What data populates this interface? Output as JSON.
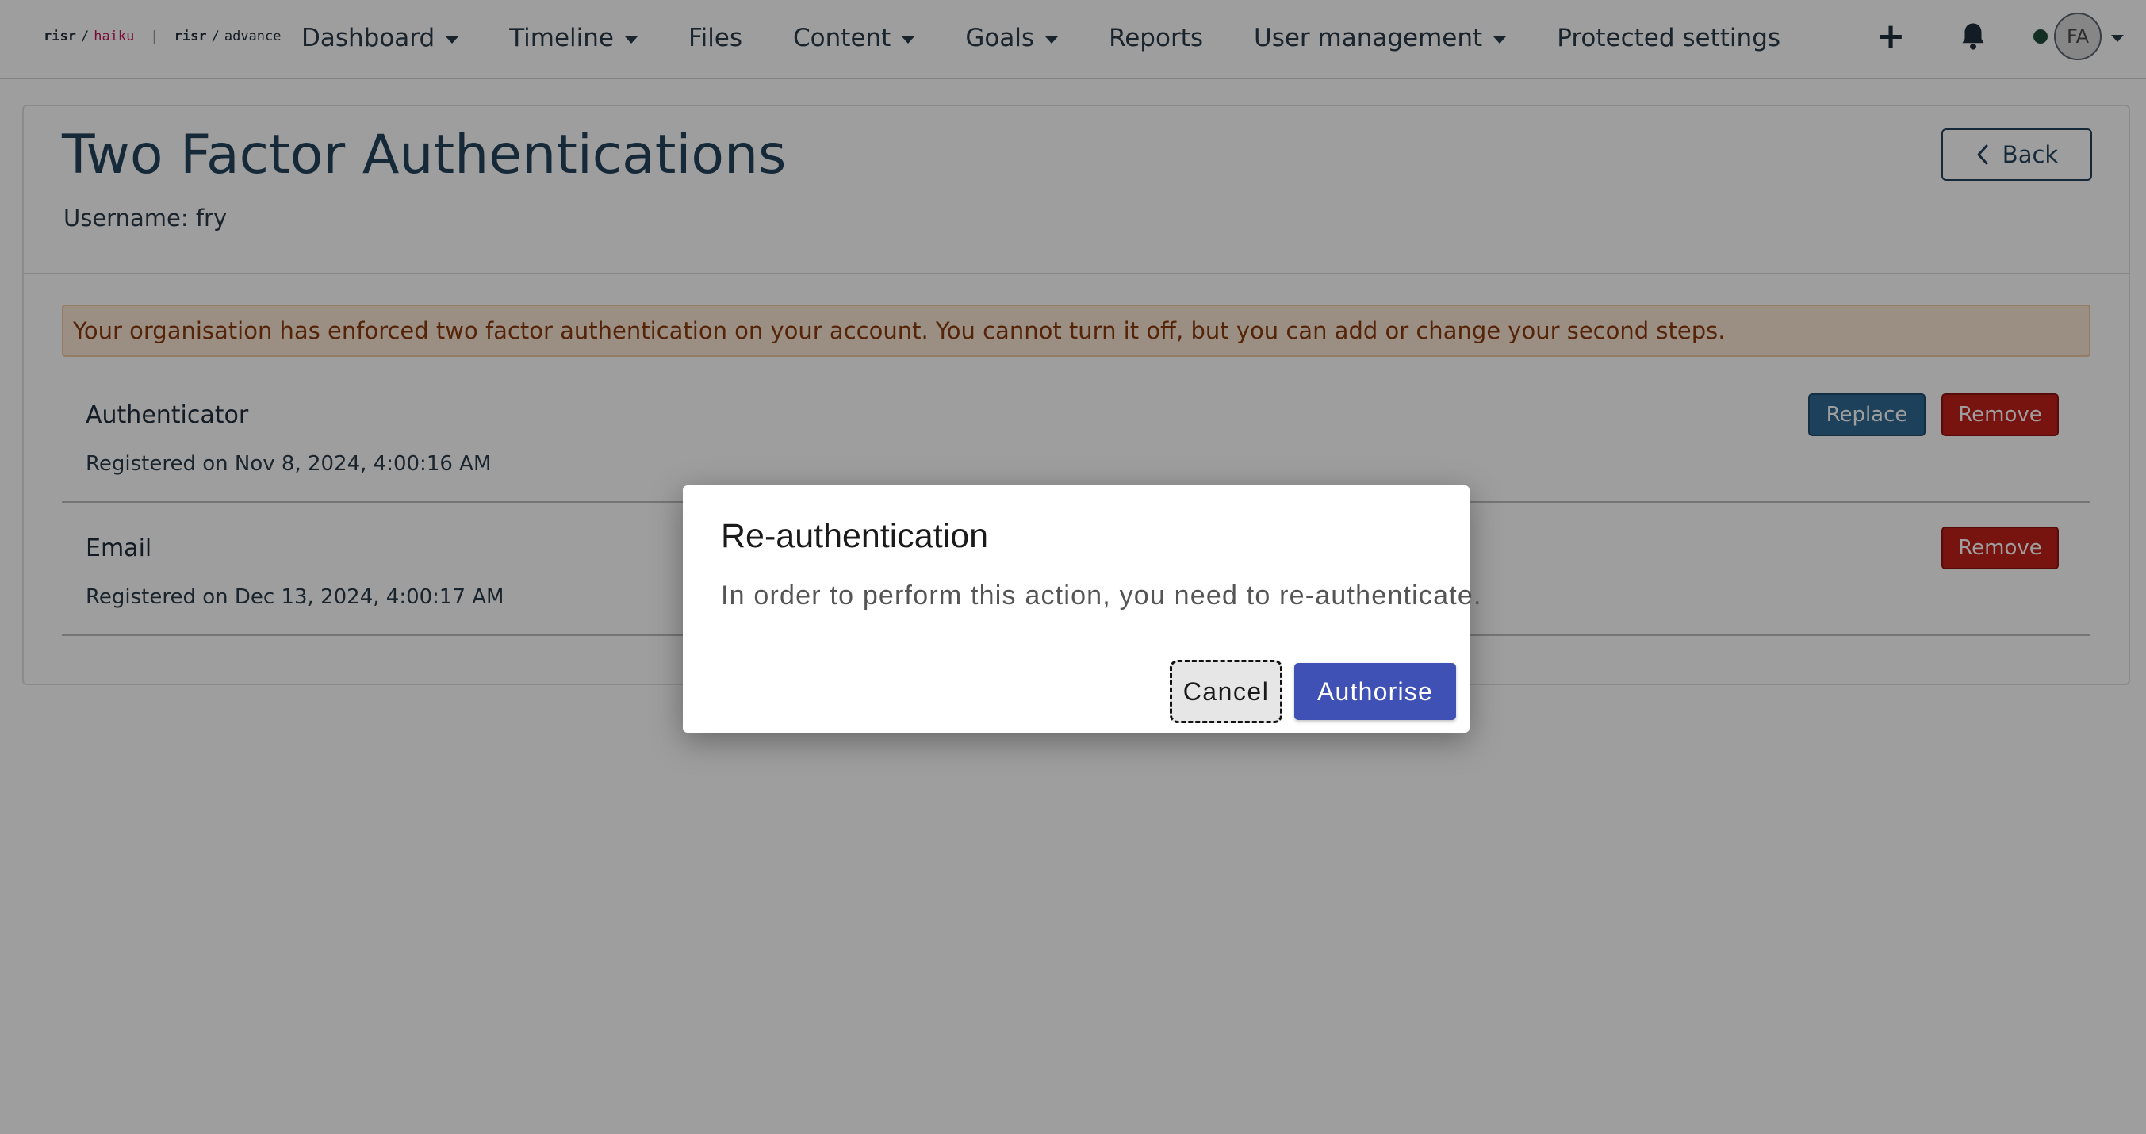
{
  "nav": {
    "logo": {
      "brand1": "risr",
      "product1": "haiku",
      "separator": "|",
      "brand2": "risr",
      "product2": "advance",
      "slash": "/"
    },
    "items": [
      {
        "label": "Dashboard",
        "has_dropdown": true
      },
      {
        "label": "Timeline",
        "has_dropdown": true
      },
      {
        "label": "Files",
        "has_dropdown": false
      },
      {
        "label": "Content",
        "has_dropdown": true
      },
      {
        "label": "Goals",
        "has_dropdown": true
      },
      {
        "label": "Reports",
        "has_dropdown": false
      },
      {
        "label": "User management",
        "has_dropdown": true
      },
      {
        "label": "Protected settings",
        "has_dropdown": false
      }
    ],
    "add_icon": "plus-icon",
    "notification_icon": "bell-icon",
    "avatar_initials": "FA",
    "status_color": "#1f4d3a"
  },
  "page": {
    "title": "Two Factor Authentications",
    "username_label": "Username: fry",
    "back_label": "Back",
    "alert_text": "Your organisation has enforced two factor authentication on your account. You cannot turn it off, but you can add or change your second steps.",
    "methods": [
      {
        "name": "Authenticator",
        "registered": "Registered on Nov 8, 2024, 4:00:16 AM",
        "replace_label": "Replace",
        "remove_label": "Remove"
      },
      {
        "name": "Email",
        "registered": "Registered on Dec 13, 2024, 4:00:17 AM",
        "remove_label": "Remove"
      }
    ]
  },
  "modal": {
    "title": "Re-authentication",
    "body": "In order to perform this action, you need to re-authenticate.",
    "cancel_label": "Cancel",
    "authorise_label": "Authorise"
  },
  "colors": {
    "title": "#25435c",
    "replace": "#2f6a93",
    "remove": "#c0211a",
    "authorise": "#3f51b5",
    "alert_bg": "#fbe6d4",
    "alert_text": "#8a3b0e"
  }
}
